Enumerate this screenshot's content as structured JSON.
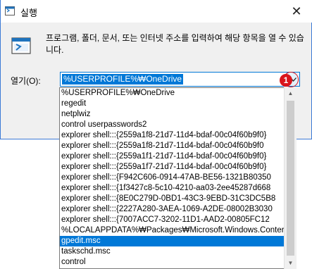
{
  "window": {
    "title": "실행"
  },
  "description": "프로그램, 폴더, 문서, 또는 인터넷 주소를 입력하여 해당 항목을 열 수 있습니다.",
  "open_label": "열기(O):",
  "combo_value": "%USERPROFILE%₩OneDrive",
  "marker": "1",
  "dropdown_items": [
    "%USERPROFILE%₩OneDrive",
    "regedit",
    "netplwiz",
    "control userpasswords2",
    "explorer shell:::{2559a1f8-21d7-11d4-bdaf-00c04f60b9f0}",
    "explorer shell:::{2559a1f8-21d7-11d4-bdaf-00c04f60b9f0",
    "explorer shell:::{2559a1f1-21d7-11d4-bdaf-00c04f60b9f0}",
    "explorer shell:::{2559a1f7-21d7-11d4-bdaf-00c04f60b9f0}",
    "explorer shell:::{F942C606-0914-47AB-BE56-1321B80350",
    "explorer shell:::{1f3427c8-5c10-4210-aa03-2ee45287d668",
    "explorer shell:::{8E0C279D-0BD1-43C3-9EBD-31C3DC5B8",
    "explorer shell:::{2227A280-3AEA-1069-A2DE-08002B3030",
    "explorer shell:::{7007ACC7-3202-11D1-AAD2-00805FC12",
    "%LOCALAPPDATA%₩Packages₩Microsoft.Windows.Conter",
    "gpedit.msc",
    "taskschd.msc",
    "control"
  ],
  "selected_index": 14,
  "colors": {
    "accent": "#0078d7",
    "marker": "#d9141b"
  }
}
